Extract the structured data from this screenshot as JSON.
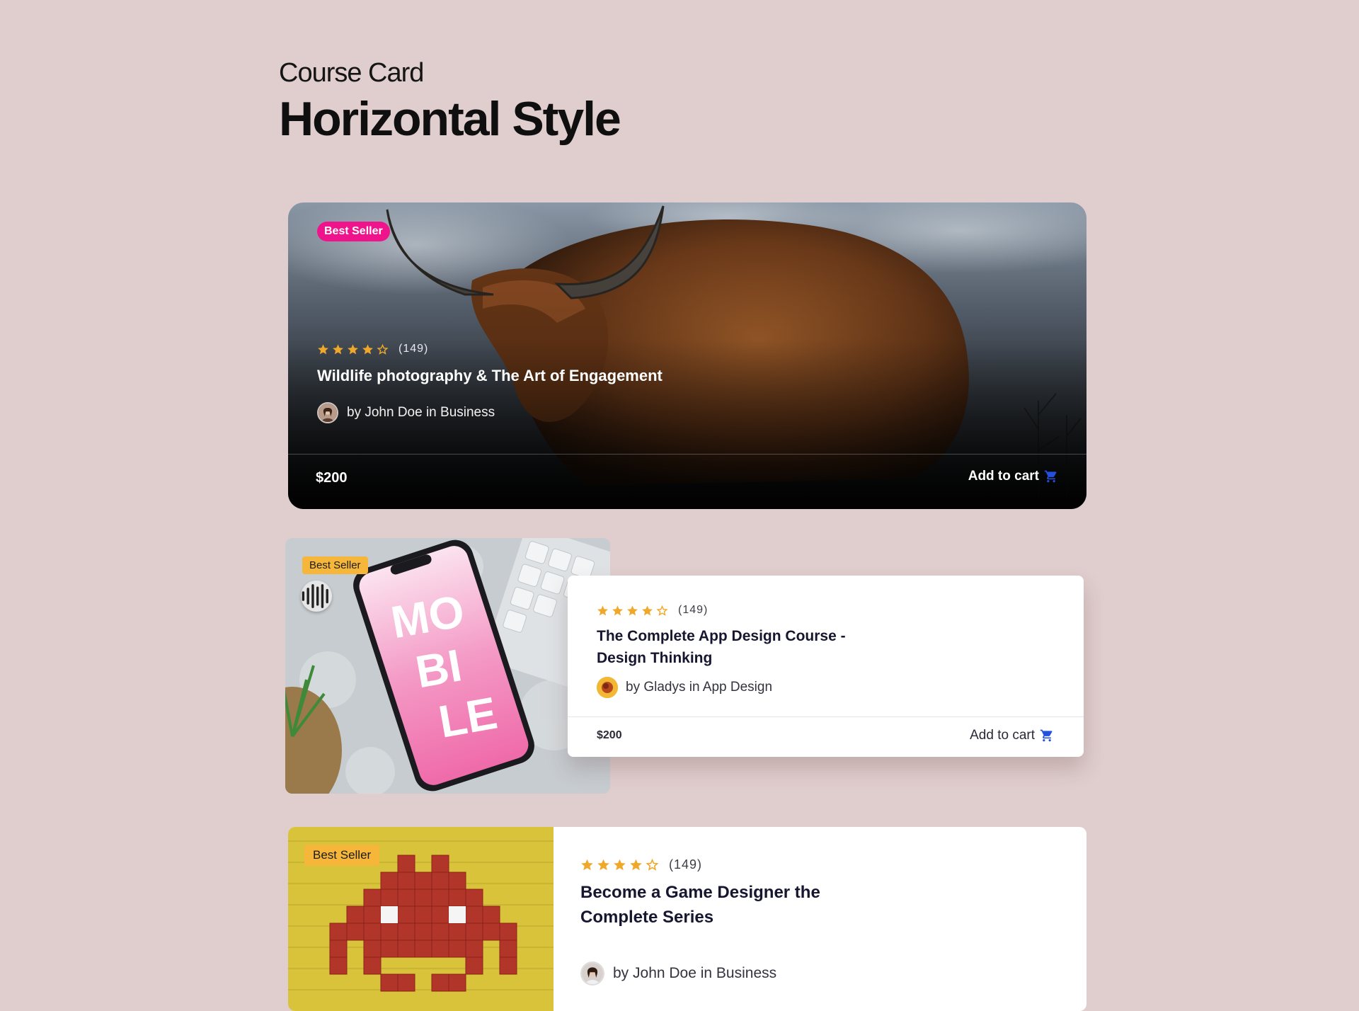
{
  "header": {
    "eyebrow": "Course Card",
    "headline": "Horizontal Style"
  },
  "colors": {
    "background": "#e0cdcd",
    "star": "#f0a82a",
    "best_seller_pink": "#f0148c",
    "best_seller_amber": "#f5b63a",
    "cart_icon": "#2450e0"
  },
  "cards": [
    {
      "badge": "Best Seller",
      "rating": 4,
      "rating_max": 5,
      "rating_count": "(149)",
      "title": "Wildlife photography & The Art of Engagement",
      "author": "by John Doe in Business",
      "price": "$200",
      "cta": "Add to cart"
    },
    {
      "badge": "Best Seller",
      "rating": 4,
      "rating_max": 5,
      "rating_count": "(149)",
      "title": "The Complete App Design Course - Design Thinking",
      "author": "by Gladys in App Design",
      "price": "$200",
      "cta": "Add to cart",
      "image_text": "MO BI LE"
    },
    {
      "badge": "Best Seller",
      "rating": 4,
      "rating_max": 5,
      "rating_count": "(149)",
      "title": "Become a Game Designer the Complete Series",
      "author": "by John Doe in Business"
    }
  ],
  "icons": {
    "star_full": "star-icon",
    "star_empty": "star-outline-icon",
    "cart": "shopping-cart-icon",
    "audio": "soundwave-icon"
  }
}
